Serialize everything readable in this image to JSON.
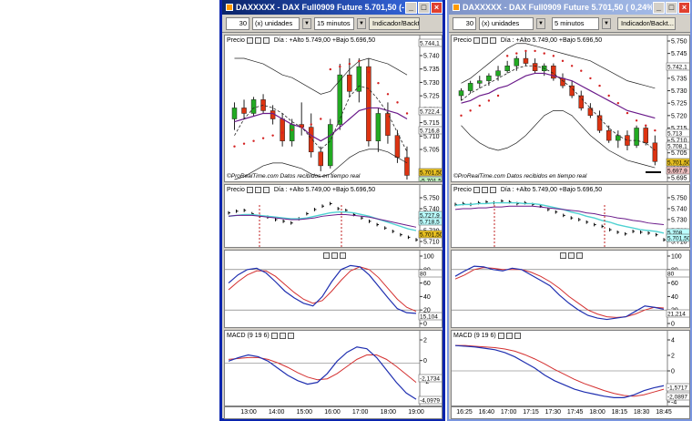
{
  "window1": {
    "title": "DAXXXXX - DAX Full0909 Future  5.701,50 (-...",
    "toolbar": {
      "interval": "30",
      "units": "(x) unidades",
      "period": "15 minutos",
      "indicator_btn": "Indicador/Backt..."
    },
    "price_panel": {
      "label": "Precio",
      "info": "Día : +Alto 5.749,00 +Bajo 5.696,50",
      "credit": "©ProRealTime.com  Datos recibidos en tiempo real",
      "y_ticks": [
        "5.740",
        "5.735",
        "5.730",
        "5.725",
        "5.720",
        "5.715",
        "5.710",
        "5.705"
      ],
      "badges": [
        "5.744,1",
        "5.722,4",
        "5.716,8",
        "5.701,50",
        "-5.701,50"
      ]
    },
    "line_panel": {
      "label": "Precio",
      "info": "Día : +Alto 5.749,00 +Bajo 5.696,50",
      "y_ticks": [
        "5.750",
        "5.740",
        "5.730",
        "5.720",
        "5.710"
      ],
      "badges": [
        "5.727,9",
        "5.718,5",
        "5.701,50"
      ]
    },
    "stoch_panel": {
      "y_ticks": [
        "100",
        "80",
        "60",
        "40",
        "20",
        "0"
      ],
      "badges": [
        "80",
        "15,104"
      ]
    },
    "macd_panel": {
      "label": "MACD (9 19 6)",
      "y_ticks": [
        "2",
        "0",
        "-2",
        "-4"
      ],
      "badges": [
        "-2,1734",
        "-4,0979"
      ]
    },
    "x_ticks": [
      "13:00",
      "14:00",
      "15:00",
      "16:00",
      "17:00",
      "18:00",
      "19:00"
    ]
  },
  "window2": {
    "title": "DAXXXXX - DAX Full0909 Future  5.701,50 ( 0,24%)...",
    "toolbar": {
      "interval": "30",
      "units": "(x) unidades",
      "period": "5 minutos",
      "indicator_btn": "Indicador/Backt..."
    },
    "price_panel": {
      "label": "Precio",
      "info": "Día : +Alto 5.749,00 +Bajo 5.696,50",
      "credit": "©ProRealTime.com  Datos recibidos en tiempo real",
      "y_ticks": [
        "5.750",
        "5.745",
        "5.740",
        "5.735",
        "5.730",
        "5.725",
        "5.720",
        "5.715",
        "5.710",
        "5.705",
        "5.700",
        "5.695"
      ],
      "badges": [
        "5.742,1",
        "5.713",
        "5.708,1",
        "5.701,50",
        "5.697,9"
      ]
    },
    "line_panel": {
      "label": "Precio",
      "info": "Día : +Alto 5.749,00 +Bajo 5.696,50",
      "y_ticks": [
        "5.750",
        "5.740",
        "5.730",
        "5.720",
        "5.710"
      ],
      "badges": [
        "5.708",
        "5.701,50"
      ]
    },
    "stoch_panel": {
      "y_ticks": [
        "100",
        "80",
        "60",
        "40",
        "20",
        "0"
      ],
      "badges": [
        "80",
        "21,214"
      ]
    },
    "macd_panel": {
      "label": "MACD (9 19 6)",
      "y_ticks": [
        "4",
        "2",
        "0",
        "-2",
        "-4"
      ],
      "badges": [
        "-1,5717",
        "-2,0897"
      ]
    },
    "x_ticks": [
      "16:25",
      "16:40",
      "17:00",
      "17:15",
      "17:30",
      "17:45",
      "18:00",
      "18:15",
      "18:30",
      "18:45"
    ]
  },
  "colors": {
    "bull": "#22aa22",
    "bear": "#dd3311",
    "sar": "#d42020",
    "ma": "#6a1a8a",
    "macd": "#1f2fb0",
    "signal": "#d43030",
    "cyan": "#4fd2d2"
  }
}
